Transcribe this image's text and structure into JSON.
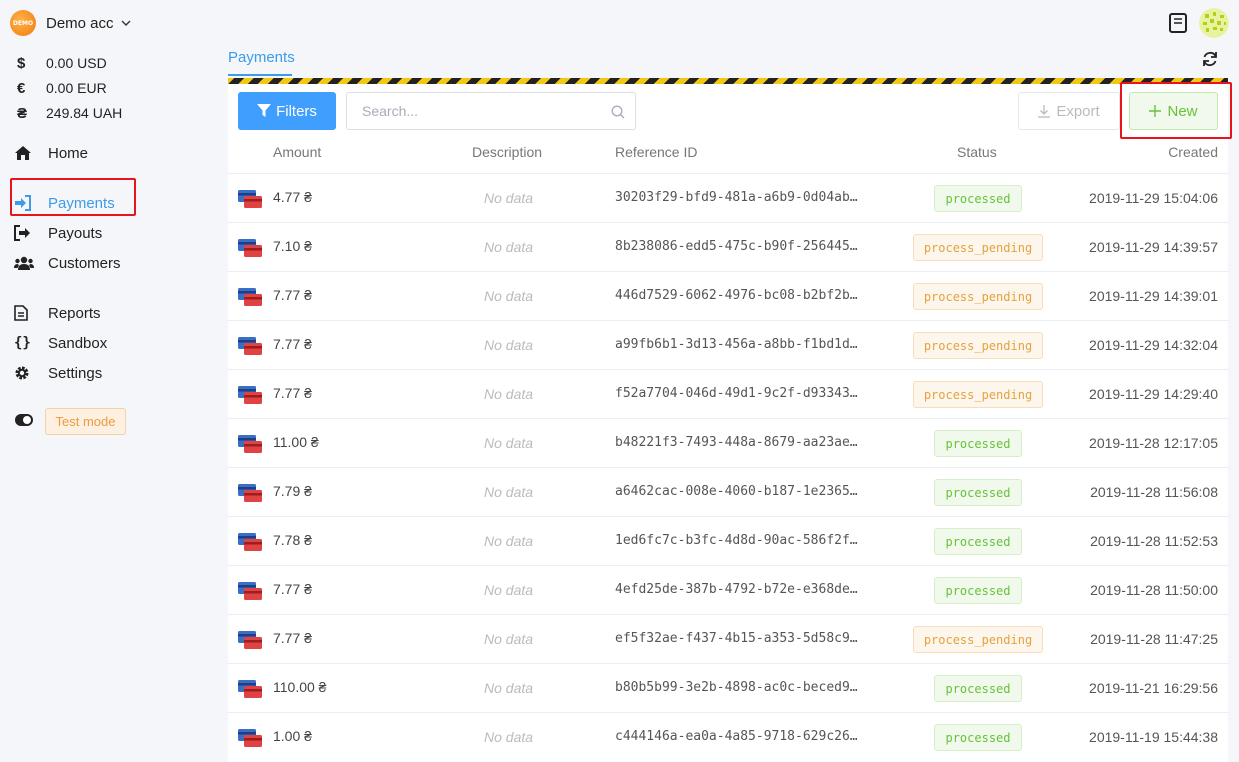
{
  "account": {
    "logo_text": "DEMO",
    "name": "Demo acc"
  },
  "balances": [
    {
      "symbol": "$",
      "amount": "0.00 USD"
    },
    {
      "symbol": "€",
      "amount": "0.00 EUR"
    },
    {
      "symbol": "₴",
      "amount": "249.84 UAH"
    }
  ],
  "nav": {
    "home": "Home",
    "payments": "Payments",
    "payouts": "Payouts",
    "customers": "Customers",
    "reports": "Reports",
    "sandbox": "Sandbox",
    "settings": "Settings"
  },
  "test_mode": "Test mode",
  "tab": "Payments",
  "toolbar": {
    "filters": "Filters",
    "search_placeholder": "Search...",
    "export": "Export",
    "new": "New"
  },
  "columns": {
    "amount": "Amount",
    "description": "Description",
    "reference": "Reference ID",
    "status": "Status",
    "created": "Created"
  },
  "rows": [
    {
      "amount": "4.77 ₴",
      "description": "No data",
      "ref": "30203f29-bfd9-481a-a6b9-0d04ab…",
      "status": "processed",
      "created": "2019-11-29 15:04:06"
    },
    {
      "amount": "7.10 ₴",
      "description": "No data",
      "ref": "8b238086-edd5-475c-b90f-256445…",
      "status": "process_pending",
      "created": "2019-11-29 14:39:57"
    },
    {
      "amount": "7.77 ₴",
      "description": "No data",
      "ref": "446d7529-6062-4976-bc08-b2bf2b…",
      "status": "process_pending",
      "created": "2019-11-29 14:39:01"
    },
    {
      "amount": "7.77 ₴",
      "description": "No data",
      "ref": "a99fb6b1-3d13-456a-a8bb-f1bd1d…",
      "status": "process_pending",
      "created": "2019-11-29 14:32:04"
    },
    {
      "amount": "7.77 ₴",
      "description": "No data",
      "ref": "f52a7704-046d-49d1-9c2f-d93343…",
      "status": "process_pending",
      "created": "2019-11-29 14:29:40"
    },
    {
      "amount": "11.00 ₴",
      "description": "No data",
      "ref": "b48221f3-7493-448a-8679-aa23ae…",
      "status": "processed",
      "created": "2019-11-28 12:17:05"
    },
    {
      "amount": "7.79 ₴",
      "description": "No data",
      "ref": "a6462cac-008e-4060-b187-1e2365…",
      "status": "processed",
      "created": "2019-11-28 11:56:08"
    },
    {
      "amount": "7.78 ₴",
      "description": "No data",
      "ref": "1ed6fc7c-b3fc-4d8d-90ac-586f2f…",
      "status": "processed",
      "created": "2019-11-28 11:52:53"
    },
    {
      "amount": "7.77 ₴",
      "description": "No data",
      "ref": "4efd25de-387b-4792-b72e-e368de…",
      "status": "processed",
      "created": "2019-11-28 11:50:00"
    },
    {
      "amount": "7.77 ₴",
      "description": "No data",
      "ref": "ef5f32ae-f437-4b15-a353-5d58c9…",
      "status": "process_pending",
      "created": "2019-11-28 11:47:25"
    },
    {
      "amount": "110.00 ₴",
      "description": "No data",
      "ref": "b80b5b99-3e2b-4898-ac0c-beced9…",
      "status": "processed",
      "created": "2019-11-21 16:29:56"
    },
    {
      "amount": "1.00 ₴",
      "description": "No data",
      "ref": "c444146a-ea0a-4a85-9718-629c26…",
      "status": "processed",
      "created": "2019-11-19 15:44:38"
    }
  ],
  "colors": {
    "accent": "#3d9be9",
    "primary_button": "#409eff",
    "success": "#67c23a",
    "warning": "#e6a23c",
    "highlight": "#e8141b"
  },
  "icons": {
    "account_chevron": "chevron-down-icon",
    "home": "home-icon",
    "payments": "sign-in-icon",
    "payouts": "sign-out-icon",
    "customers": "users-icon",
    "reports": "file-icon",
    "sandbox": "braces-icon",
    "settings": "gear-icon",
    "test_mode": "toggle-icon",
    "docs": "book-icon",
    "refresh": "refresh-icon",
    "filters": "funnel-icon",
    "search": "search-icon",
    "export": "download-icon",
    "new": "plus-icon",
    "row": "credit-card-icon"
  }
}
